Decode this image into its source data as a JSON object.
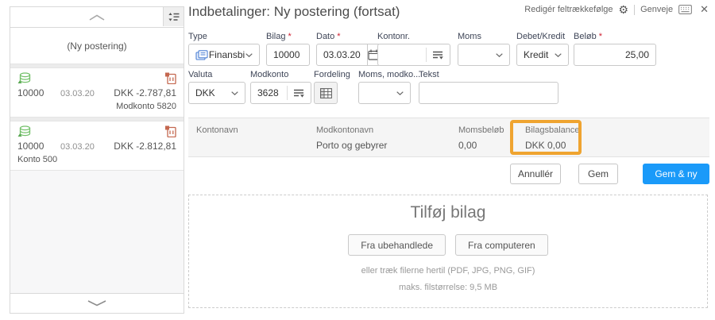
{
  "header": {
    "title": "Indbetalinger: Ny postering (fortsat)"
  },
  "toolbar": {
    "edit_field_order": "Redigér feltrækkefølge",
    "shortcuts": "Genveje"
  },
  "icons": {
    "gear": "⚙",
    "close": "✕"
  },
  "sidebar": {
    "new_entry_label": "(Ny postering)",
    "entries": [
      {
        "number": "10000",
        "date": "03.03.20",
        "amount": "DKK -2.787,81",
        "note": "Modkonto 5820"
      },
      {
        "number": "10000",
        "date": "03.03.20",
        "amount": "DKK -2.812,81",
        "note": "Konto 500"
      }
    ]
  },
  "form": {
    "required_marker": "*",
    "type": {
      "label": "Type",
      "value": "Finansbi"
    },
    "bilag": {
      "label": "Bilag",
      "value": "10000"
    },
    "dato": {
      "label": "Dato",
      "value": "03.03.20"
    },
    "kontonr": {
      "label": "Kontonr.",
      "value": ""
    },
    "moms": {
      "label": "Moms",
      "value": ""
    },
    "debet_kredit": {
      "label": "Debet/Kredit",
      "value": "Kredit"
    },
    "beloeb": {
      "label": "Beløb",
      "value": "25,00"
    },
    "valuta": {
      "label": "Valuta",
      "value": "DKK"
    },
    "modkonto": {
      "label": "Modkonto",
      "value": "3628"
    },
    "fordeling": {
      "label": "Fordeling"
    },
    "moms_modkonto": {
      "label": "Moms, modko...",
      "value": ""
    },
    "tekst": {
      "label": "Tekst",
      "value": ""
    }
  },
  "summary": {
    "kontonavn": {
      "label": "Kontonavn",
      "value": ""
    },
    "modkontonavn": {
      "label": "Modkontonavn",
      "value": "Porto og gebyrer"
    },
    "momsbeloeb": {
      "label": "Momsbeløb",
      "value": "0,00"
    },
    "bilagsbalance": {
      "label": "Bilagsbalance",
      "value": "DKK 0,00"
    }
  },
  "actions": {
    "cancel": "Annullér",
    "save": "Gem",
    "save_and_new": "Gem & ny"
  },
  "upload": {
    "title": "Tilføj bilag",
    "from_pending": "Fra ubehandlede",
    "from_computer": "Fra computeren",
    "drag_hint": "eller træk filerne hertil (PDF, JPG, PNG, GIF)",
    "max_size": "maks. filstørrelse: 9,5 MB"
  },
  "colors": {
    "accent_blue": "#1a9af9",
    "highlight_orange": "#efa430",
    "required_red": "#cf2233",
    "entry_cash_green": "#72c069",
    "entry_voucher_orange": "#c4674f"
  }
}
